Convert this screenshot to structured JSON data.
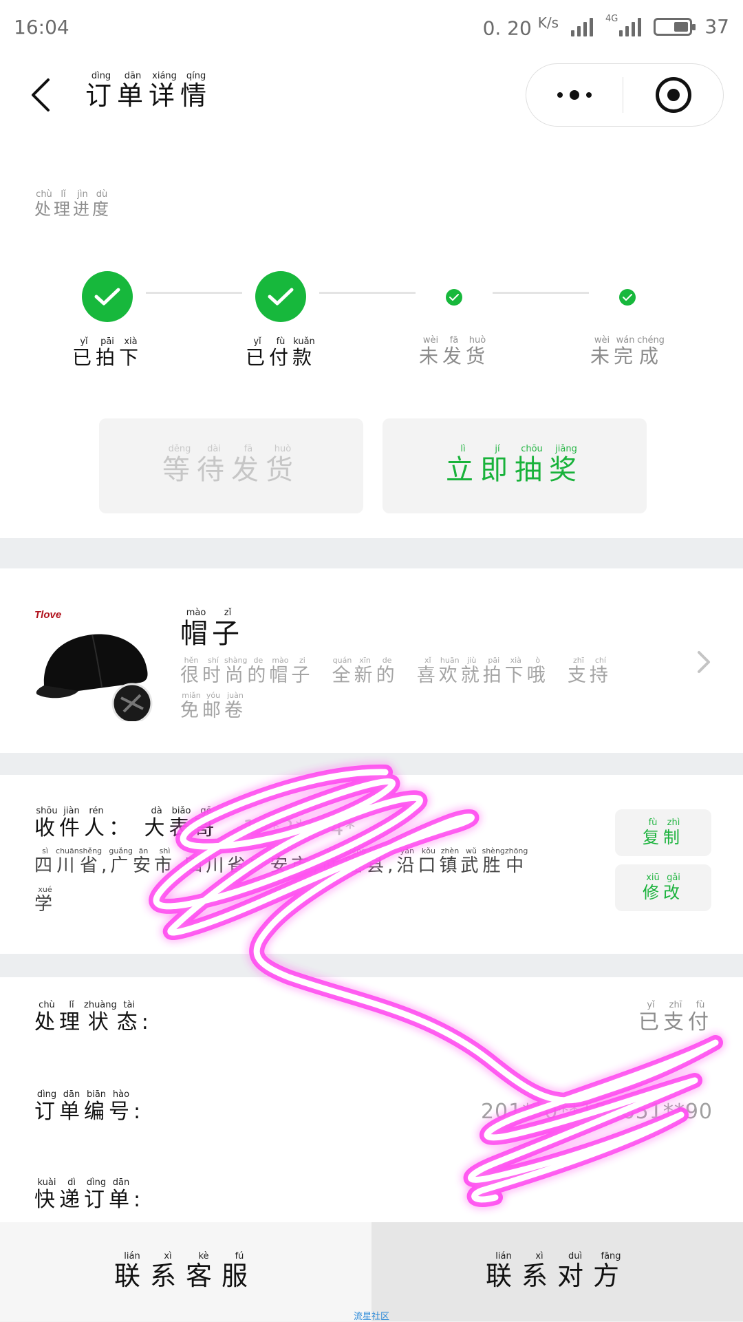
{
  "status_bar": {
    "time": "16:04",
    "speed": "0. 20",
    "speed_unit": "K/s",
    "network": "4G",
    "battery": "37"
  },
  "nav": {
    "title": {
      "chars": [
        "订",
        "单",
        "详",
        "情"
      ],
      "pinyin": [
        "dìng",
        "dān",
        "xiáng",
        "qíng"
      ]
    }
  },
  "progress": {
    "title": {
      "chars": [
        "处",
        "理",
        "进",
        "度"
      ],
      "pinyin": [
        "chù",
        "lǐ",
        "jìn",
        "dù"
      ]
    },
    "steps": [
      {
        "chars": [
          "已",
          "拍",
          "下"
        ],
        "pinyin": [
          "yǐ",
          "pāi",
          "xià"
        ],
        "status": "done"
      },
      {
        "chars": [
          "已",
          "付",
          "款"
        ],
        "pinyin": [
          "yǐ",
          "fù",
          "kuǎn"
        ],
        "status": "done"
      },
      {
        "chars": [
          "未",
          "发",
          "货"
        ],
        "pinyin": [
          "wèi",
          "fā",
          "huò"
        ],
        "status": "todo"
      },
      {
        "chars": [
          "未",
          "完",
          "成"
        ],
        "pinyin": [
          "wèi",
          "wán",
          "chéng"
        ],
        "status": "todo"
      }
    ],
    "wait_button": {
      "chars": [
        "等",
        "待",
        "发",
        "货"
      ],
      "pinyin": [
        "děng",
        "dài",
        "fā",
        "huò"
      ]
    },
    "lottery_button": {
      "chars": [
        "立",
        "即",
        "抽",
        "奖"
      ],
      "pinyin": [
        "lì",
        "jí",
        "chōu",
        "jiǎng"
      ]
    }
  },
  "product": {
    "brand_text": "Tlove",
    "name": {
      "chars": [
        "帽",
        "子"
      ],
      "pinyin": [
        "mào",
        "zǐ"
      ]
    },
    "desc_line1": {
      "chars": [
        "很",
        "时",
        "尚",
        "的",
        "帽",
        "子",
        " ",
        "全",
        "新",
        "的",
        " ",
        "喜",
        "欢",
        "就",
        "拍",
        "下",
        "哦",
        " ",
        "支",
        "持"
      ],
      "pinyin": [
        "hěn",
        "shí",
        "shàng",
        "de",
        "mào",
        "zi",
        "",
        " quán",
        "xīn",
        "de",
        "",
        "xǐ",
        "huān",
        "jiù",
        "pāi",
        "xià",
        "ò",
        "",
        "zhī",
        "chí"
      ]
    },
    "desc_line2": {
      "chars": [
        "免",
        "邮",
        "卷"
      ],
      "pinyin": [
        "miǎn",
        "yóu",
        "juàn"
      ]
    }
  },
  "address": {
    "receiver_label": {
      "chars": [
        "收",
        "件",
        "人",
        "："
      ],
      "pinyin": [
        "shōu",
        "jiàn",
        "rén",
        ""
      ]
    },
    "receiver_name": {
      "chars": [
        "大",
        "表",
        "哥"
      ],
      "pinyin": [
        "dà",
        "biǎo",
        "gē"
      ]
    },
    "phone": "1**2***4*",
    "addr_line1": {
      "chars": [
        "四",
        "川",
        "省",
        ",",
        "广",
        "安",
        "市",
        ",",
        "四",
        "川",
        "省",
        "广",
        "安",
        "市",
        ",",
        "武",
        "胜",
        "县",
        ",",
        "沿",
        "口",
        "镇",
        "武",
        "胜",
        "中"
      ],
      "pinyin": [
        "sì",
        "chuān",
        "shěng",
        "",
        "guǎng",
        "ān",
        "shì",
        "",
        "",
        "",
        "",
        "",
        "",
        "",
        "",
        "wǔ",
        "shèng",
        "xiàn",
        "",
        "yán",
        "kǒu",
        "zhèn",
        "wǔ",
        "shèng",
        "zhōng"
      ]
    },
    "addr_line2": {
      "chars": [
        "学"
      ],
      "pinyin": [
        "xué"
      ]
    },
    "copy_button": {
      "chars": [
        "复",
        "制"
      ],
      "pinyin": [
        "fù",
        "zhì"
      ]
    },
    "edit_button": {
      "chars": [
        "修",
        "改"
      ],
      "pinyin": [
        "xiū",
        "gǎi"
      ]
    }
  },
  "info": {
    "status_label": {
      "chars": [
        "处",
        "理",
        "状",
        "态",
        ":"
      ],
      "pinyin": [
        "chù",
        "lǐ",
        "zhuàng",
        "tài",
        ""
      ]
    },
    "status_value": {
      "chars": [
        "已",
        "支",
        "付"
      ],
      "pinyin": [
        "yǐ",
        "zhī",
        "fù"
      ]
    },
    "order_no_label": {
      "chars": [
        "订",
        "单",
        "编",
        "号",
        ":"
      ],
      "pinyin": [
        "dìng",
        "dān",
        "biān",
        "hào",
        ""
      ]
    },
    "order_no_value": "201**0**102651**90",
    "express_label": {
      "chars": [
        "快",
        "递",
        "订",
        "单",
        ":"
      ],
      "pinyin": [
        "kuài",
        "dì",
        "dìng",
        "dān",
        ""
      ]
    }
  },
  "bottom": {
    "service": {
      "chars": [
        "联",
        "系",
        "客",
        "服"
      ],
      "pinyin": [
        "lián",
        "xì",
        "kè",
        "fú"
      ]
    },
    "contact": {
      "chars": [
        "联",
        "系",
        "对",
        "方"
      ],
      "pinyin": [
        "lián",
        "xì",
        "duì",
        "fāng"
      ]
    }
  },
  "watermark": "流星社区",
  "colors": {
    "accent_green": "#17b83c",
    "scribble": "#ff3cf0"
  },
  "icons": {
    "back": "chevron-left-icon",
    "more": "more-dots-icon",
    "close_target": "target-icon",
    "check": "check-icon",
    "arrow": "chevron-right-icon"
  }
}
